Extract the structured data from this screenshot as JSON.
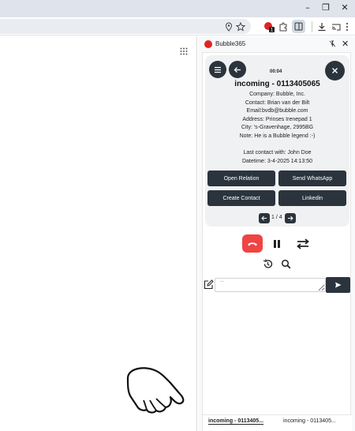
{
  "browser": {
    "window_controls": [
      "–",
      "❐",
      "✕"
    ],
    "omnibox_value": ""
  },
  "panel": {
    "title": "Bubble365",
    "close_label": "✕"
  },
  "call": {
    "timer": "00:04",
    "title": "incoming - 0113405065",
    "company": "Company: Bubble, Inc.",
    "contact": "Contact: Brian van der Bilt",
    "email": "Email:bvdb@bubble.com",
    "address": "Address: Prinses Irenepad 1",
    "city": "City: 's-Gravenhage, 2995BG",
    "note": "Note: He is a Bubble legend :-)",
    "last_contact": "Last contact with: John Doe",
    "datetime": "Datetime: 3-4-2025 14:13:50"
  },
  "actions": {
    "open_relation": "Open Relation",
    "send_whatsapp": "Send WhatsApp",
    "create_contact": "Create Contact",
    "linkedin": "Linkedin"
  },
  "pager": {
    "text": "1 / 4"
  },
  "message": {
    "placeholder": "..."
  },
  "tabs": [
    {
      "label": "incoming - 0113405..."
    },
    {
      "label": "incoming - 0113405..."
    }
  ],
  "colors": {
    "dark_button": "#2b343d",
    "hangup": "#ef4444",
    "logo": "#e02424"
  }
}
